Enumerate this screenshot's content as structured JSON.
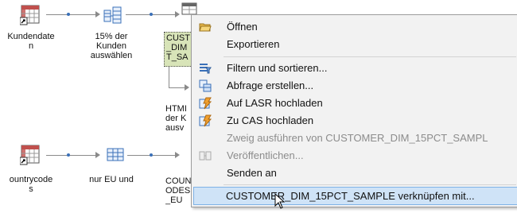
{
  "diagram": {
    "nodes": [
      {
        "label": "Kundendate\nn"
      },
      {
        "label": "15% der\nKunden\nauswählen"
      },
      {
        "label": "CUST\n_DIM\nT_SA"
      },
      {
        "label": "HTMI\nder K\nausv"
      },
      {
        "label": "ountrycode\ns"
      },
      {
        "label": "nur EU und"
      },
      {
        "label": "COUN\nODES\n_EU"
      }
    ]
  },
  "context_menu": {
    "items": [
      {
        "label": "Öffnen",
        "icon": "open-folder-icon",
        "enabled": true
      },
      {
        "label": "Exportieren",
        "icon": "",
        "enabled": true
      },
      {
        "label": "Filtern und sortieren...",
        "icon": "filter-icon",
        "enabled": true
      },
      {
        "label": "Abfrage erstellen...",
        "icon": "query-icon",
        "enabled": true
      },
      {
        "label": "Auf LASR hochladen",
        "icon": "upload-lasr-icon",
        "enabled": true
      },
      {
        "label": "Zu CAS hochladen",
        "icon": "upload-cas-icon",
        "enabled": true
      },
      {
        "label": "Zweig ausführen von CUSTOMER_DIM_15PCT_SAMPL",
        "icon": "",
        "enabled": false
      },
      {
        "label": "Veröffentlichen...",
        "icon": "publish-icon",
        "enabled": false
      },
      {
        "label": "Senden an",
        "icon": "",
        "enabled": true
      },
      {
        "label": "CUSTOMER_DIM_15PCT_SAMPLE verknüpfen mit...",
        "icon": "",
        "enabled": true,
        "hovered": true
      }
    ]
  },
  "colors": {
    "menu_bg": "#f2f2f2",
    "hover_bg": "#cfe3f7",
    "selection_bg": "#d8e4b8",
    "disabled_text": "#8c8c8c"
  }
}
